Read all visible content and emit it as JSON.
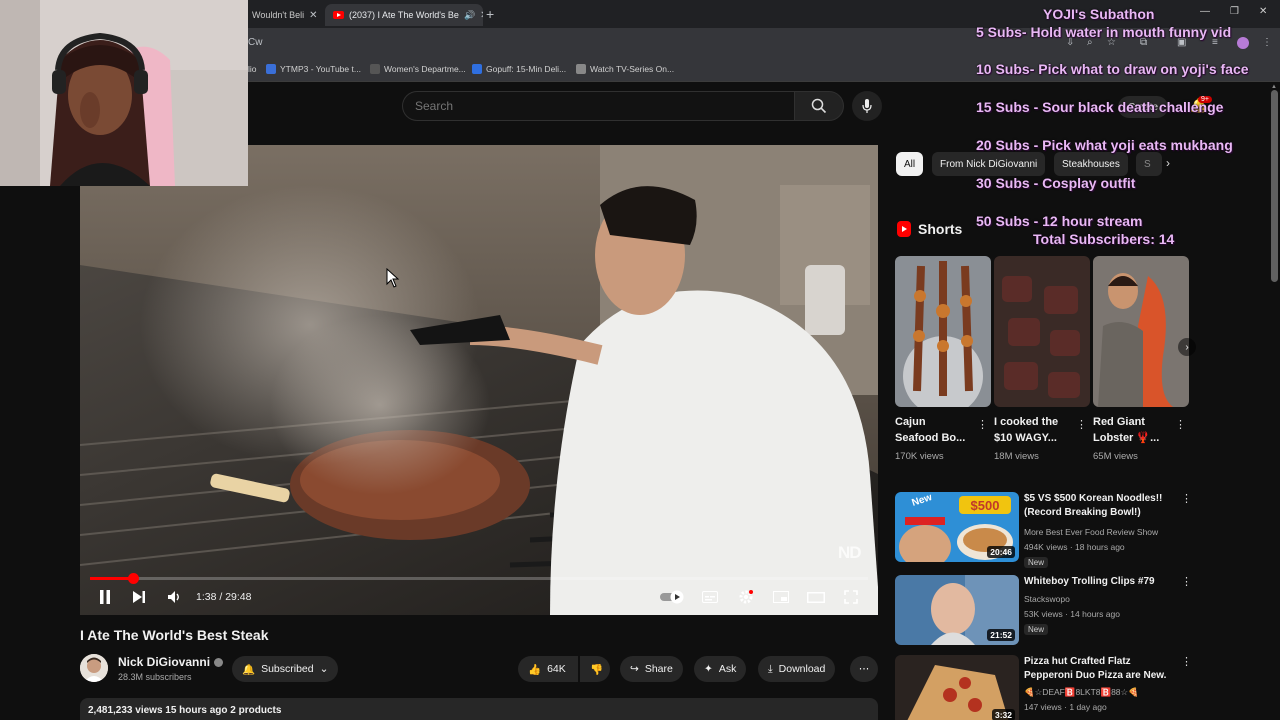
{
  "browser": {
    "tabs": [
      {
        "label": "Wouldn't Beli",
        "active": false
      },
      {
        "label": "(2037) I Ate The World's Be",
        "active": true
      }
    ],
    "url_fragment": "Cw",
    "bookmarks": [
      {
        "label": "lio"
      },
      {
        "label": "YTMP3 - YouTube t..."
      },
      {
        "label": "Women's Departme..."
      },
      {
        "label": "Gopuff: 15-Min Deli..."
      },
      {
        "label": "Watch TV-Series On..."
      }
    ]
  },
  "header": {
    "search_placeholder": "Search",
    "create_label": "Create",
    "notification_count": "9+"
  },
  "player": {
    "current_time": "1:38",
    "duration": "29:48",
    "time_display": "1:38 / 29:48",
    "watermark": "ND",
    "progress_fraction": 0.055
  },
  "video": {
    "title": "I Ate The World's Best Steak",
    "channel": "Nick DiGiovanni",
    "subscribers": "28.3M subscribers",
    "subscribe_label": "Subscribed",
    "likes": "64K",
    "share_label": "Share",
    "ask_label": "Ask",
    "download_label": "Download",
    "meta": "2,481,233 views  15 hours ago  2 products"
  },
  "chips": [
    "All",
    "From Nick DiGiovanni",
    "Steakhouses",
    "S"
  ],
  "shorts": {
    "title": "Shorts",
    "items": [
      {
        "title": "Cajun Seafood Bo...",
        "views": "170K views"
      },
      {
        "title": "I cooked the $10 WAGY...",
        "views": "18M views"
      },
      {
        "title": "Red Giant Lobster 🦞...",
        "views": "65M views"
      }
    ]
  },
  "recommendations": [
    {
      "title": "$5 VS $500 Korean Noodles!! (Record Breaking Bowl!)",
      "channel": "More Best Ever Food Review Show",
      "meta": "494K views · 18 hours ago",
      "badge": "New",
      "duration": "20:46"
    },
    {
      "title": "Whiteboy Trolling Clips #79",
      "channel": "Stackswopo",
      "meta": "53K views · 14 hours ago",
      "badge": "New",
      "duration": "21:52"
    },
    {
      "title": "Pizza hut Crafted Flatz Pepperoni Duo Pizza are New.",
      "channel": "🍕☆DEAF🅱️8LKT8🅱️88☆🍕",
      "meta": "147 views · 1 day ago",
      "badge": "",
      "duration": "3:32"
    }
  ],
  "overlay": {
    "heading": "YOJI's Subathon",
    "lines": [
      "5 Subs- Hold water in mouth funny vid",
      "10 Subs- Pick what to draw on yoji's face",
      "15 Subs - Sour black death challenge",
      "20 Subs - Pick what yoji eats mukbang",
      "30 Subs - Cosplay outfit",
      "50 Subs - 12 hour stream",
      "Total Subscribers: 14"
    ]
  }
}
